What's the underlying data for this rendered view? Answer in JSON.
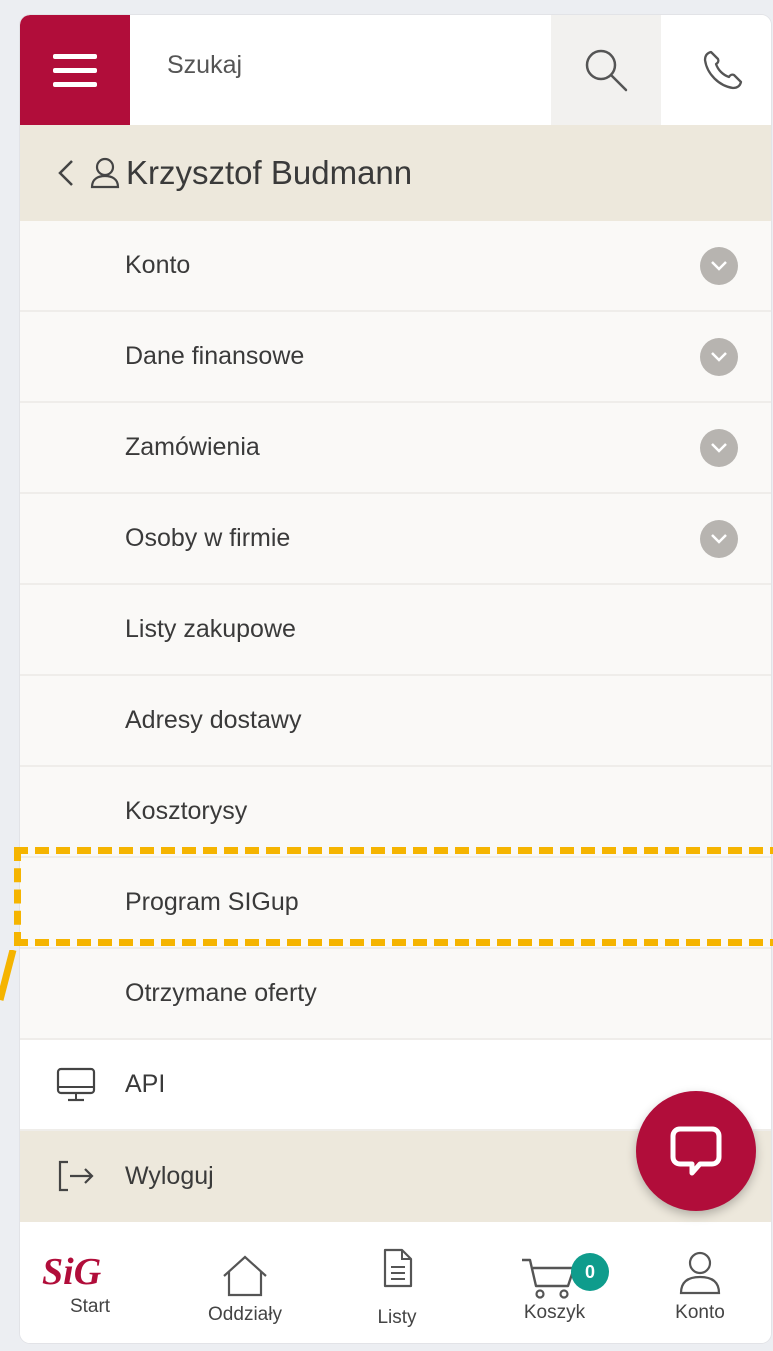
{
  "header": {
    "menu_icon": "hamburger-icon",
    "search_placeholder": "Szukaj",
    "search_icon": "search-icon",
    "phone_icon": "phone-icon",
    "brand_color": "#b10d3a"
  },
  "user": {
    "back_icon": "chevron-left-icon",
    "person_icon": "user-icon",
    "name": "Krzysztof Budmann"
  },
  "menu": {
    "items": [
      {
        "label": "Konto",
        "expandable": true
      },
      {
        "label": "Dane finansowe",
        "expandable": true
      },
      {
        "label": "Zamówienia",
        "expandable": true
      },
      {
        "label": "Osoby w firmie",
        "expandable": true
      },
      {
        "label": "Listy zakupowe",
        "expandable": false
      },
      {
        "label": "Adresy dostawy",
        "expandable": false
      },
      {
        "label": "Kosztorysy",
        "expandable": false
      },
      {
        "label": "Program SIGup",
        "expandable": false,
        "highlighted": true
      },
      {
        "label": "Otrzymane oferty",
        "expandable": false
      }
    ],
    "api_label": "API",
    "logout_label": "Wyloguj"
  },
  "bottom_nav": {
    "start_logo": "SiG",
    "start": "Start",
    "oddzialy": "Oddziały",
    "listy": "Listy",
    "koszyk": "Koszyk",
    "cart_count": "0",
    "konto": "Konto",
    "badge_color": "#0f9c8c"
  },
  "chat": {
    "icon": "chat-bubble-icon"
  },
  "annotation": {
    "color": "#f5b400",
    "target": "Program SIGup"
  }
}
